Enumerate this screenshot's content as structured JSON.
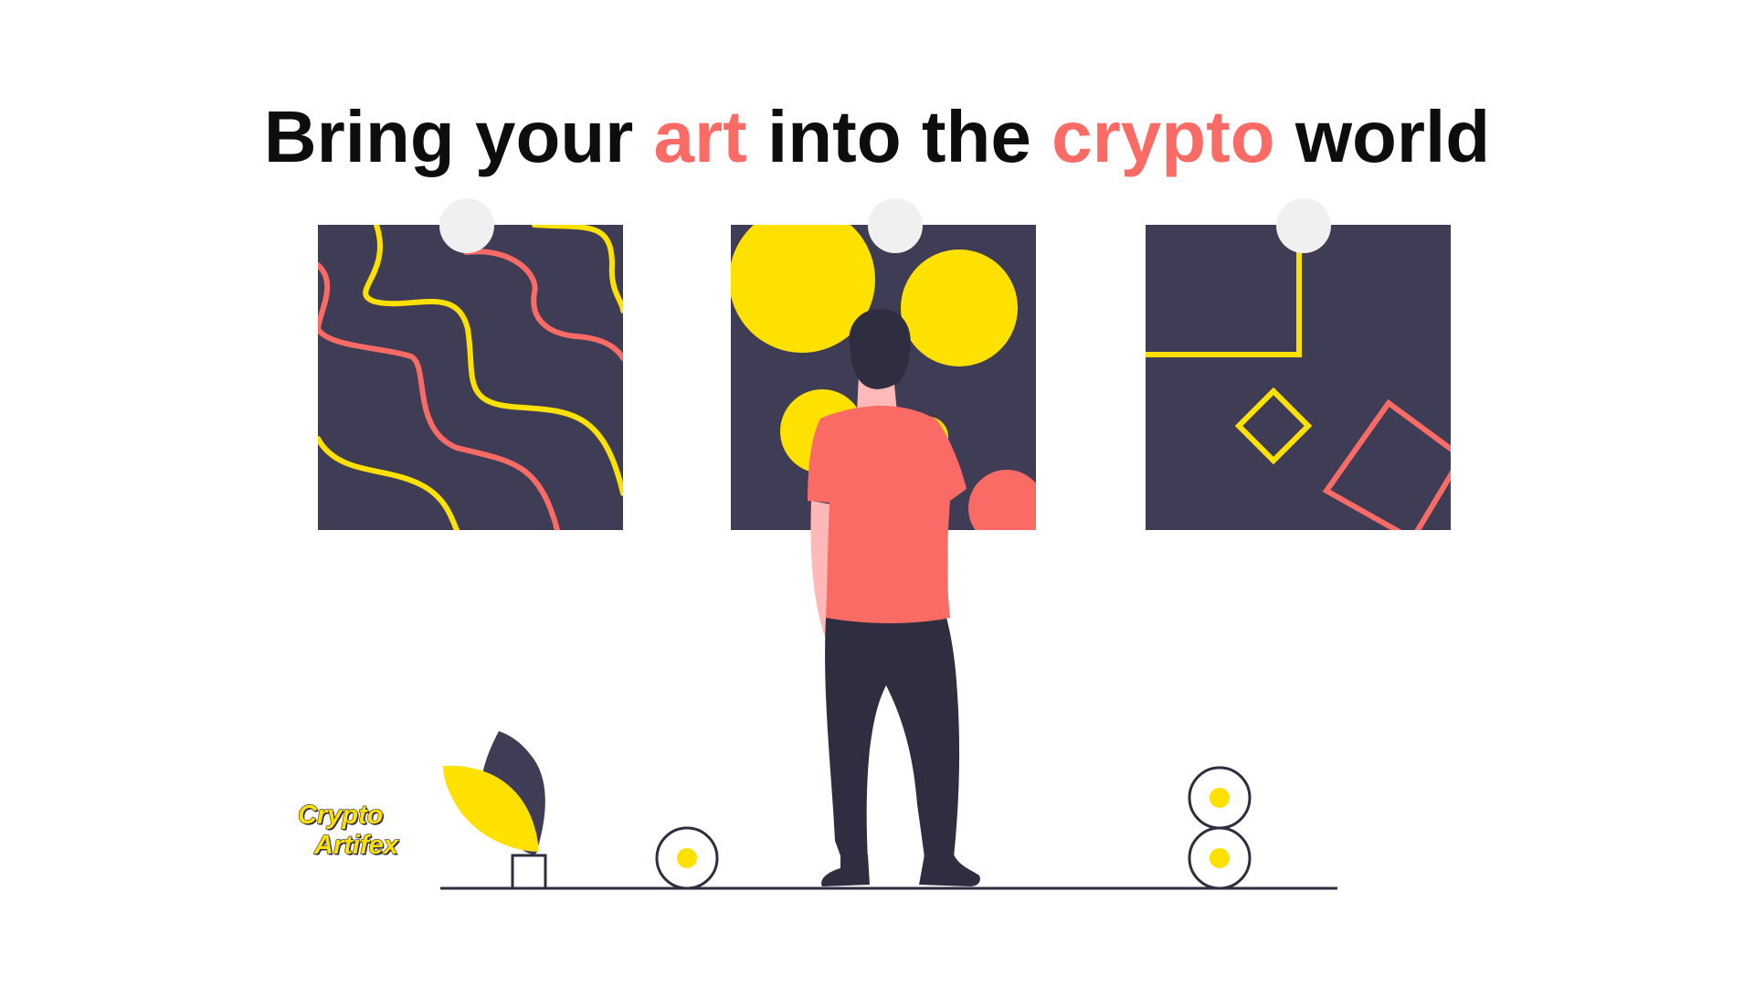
{
  "headline": {
    "part1": "Bring your ",
    "accent1": "art",
    "part2": " into the ",
    "accent2": "crypto",
    "part3": " world"
  },
  "logo": {
    "line1": "Crypto",
    "line2": "Artifex"
  },
  "colors": {
    "accent": "#fb6b66",
    "yellow": "#ffe100",
    "panel": "#3f3d56",
    "dark": "#2f2e41",
    "pin": "#f0f0f0"
  },
  "icons": {
    "pins": "pin-icon",
    "coins": "coin-icon",
    "plant": "plant-icon",
    "person": "person-illustration"
  }
}
